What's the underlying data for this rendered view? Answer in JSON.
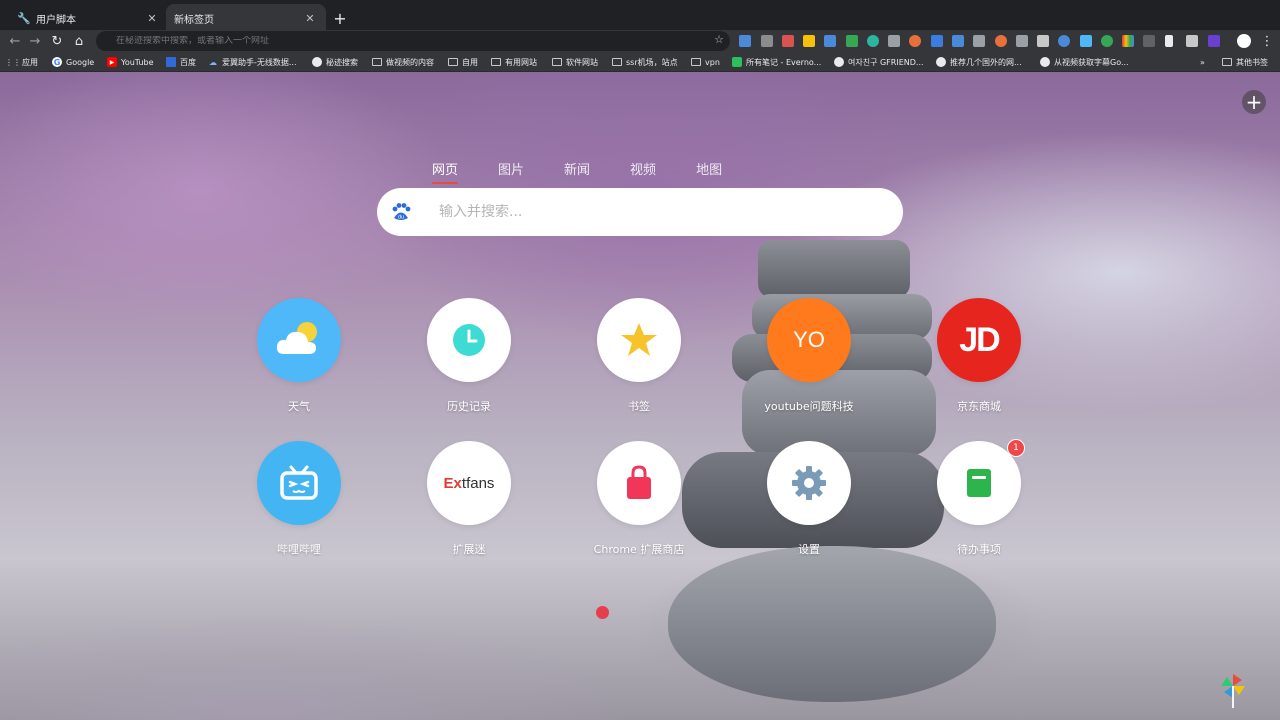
{
  "tabs": [
    {
      "title": "用户脚本",
      "active": false
    },
    {
      "title": "新标签页",
      "active": true
    }
  ],
  "omnibox": {
    "placeholder": "在秘迹搜索中搜索，或者输入一个网址"
  },
  "bookmarks": [
    {
      "label": "应用",
      "icon": "apps-icon"
    },
    {
      "label": "Google",
      "icon": "google-icon"
    },
    {
      "label": "YouTube",
      "icon": "youtube-icon"
    },
    {
      "label": "百度",
      "icon": "baidu-icon"
    },
    {
      "label": "爱翼助手-无线数据...",
      "icon": "site-icon"
    },
    {
      "label": "秘迹搜索",
      "icon": "globe-icon"
    },
    {
      "label": "做视频的内容",
      "icon": "folder-icon"
    },
    {
      "label": "自用",
      "icon": "folder-icon"
    },
    {
      "label": "有用网站",
      "icon": "folder-icon"
    },
    {
      "label": "软件网站",
      "icon": "folder-icon"
    },
    {
      "label": "ssr机场，站点",
      "icon": "folder-icon"
    },
    {
      "label": "vpn",
      "icon": "folder-icon"
    },
    {
      "label": "所有笔记 - Everno...",
      "icon": "evernote-icon"
    },
    {
      "label": "여자친구 GFRIEND...",
      "icon": "globe-icon"
    },
    {
      "label": "推荐几个国外的网...",
      "icon": "globe-icon"
    },
    {
      "label": "从视频获取字幕Go...",
      "icon": "globe-icon"
    }
  ],
  "bookmarks_more": "»",
  "other_bookmarks": "其他书签",
  "search": {
    "tabs": [
      "网页",
      "图片",
      "新闻",
      "视频",
      "地图"
    ],
    "active_tab": "网页",
    "placeholder": "输入并搜索..."
  },
  "apps": [
    {
      "label": "天气",
      "icon": "weather-icon"
    },
    {
      "label": "历史记录",
      "icon": "clock-icon"
    },
    {
      "label": "书签",
      "icon": "star-icon"
    },
    {
      "label": "youtube问题科技",
      "icon": "avatar",
      "avatar_text": "YO"
    },
    {
      "label": "京东商城",
      "icon": "jd-icon",
      "avatar_text": "JD"
    },
    {
      "label": "哔哩哔哩",
      "icon": "bilibili-icon"
    },
    {
      "label": "扩展迷",
      "icon": "extfans-icon",
      "logo_ex": "Ex",
      "logo_rest": "tfans"
    },
    {
      "label": "Chrome 扩展商店",
      "icon": "store-bag-icon"
    },
    {
      "label": "设置",
      "icon": "gear-icon"
    },
    {
      "label": "待办事项",
      "icon": "todo-icon",
      "badge": "1"
    }
  ],
  "colors": {
    "weather_bg": "#4fb8f8",
    "history_icon": "#3ddbd3",
    "star": "#f6c32b",
    "youtube_avatar": "#ff7a1c",
    "jd_red": "#e6251f",
    "bilibili_bg": "#43b5f3",
    "extfans_red": "#e53935",
    "store_pink": "#f2365a",
    "gear_blue": "#7a9bb8",
    "todo_green": "#2db54b",
    "badge_red": "#f04848"
  }
}
